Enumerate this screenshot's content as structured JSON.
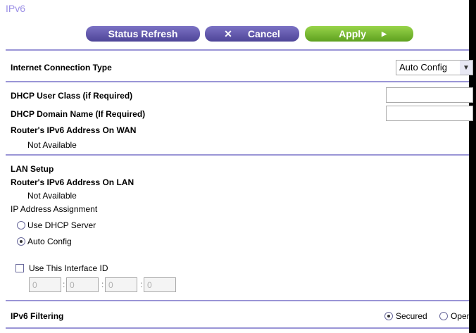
{
  "page": {
    "title": "IPv6"
  },
  "toolbar": {
    "status_refresh_label": "Status Refresh",
    "cancel_label": "Cancel",
    "apply_label": "Apply"
  },
  "internet_connection": {
    "label": "Internet Connection Type",
    "selected": "Auto Config"
  },
  "dhcp": {
    "user_class_label": "DHCP User Class (if Required)",
    "user_class_value": "",
    "domain_name_label": "DHCP Domain Name  (If Required)",
    "domain_name_value": ""
  },
  "wan": {
    "address_label": "Router's IPv6 Address On WAN",
    "address_value": "Not Available"
  },
  "lan": {
    "section_label": "LAN Setup",
    "address_label": "Router's IPv6 Address On LAN",
    "address_value": "Not Available",
    "assignment_label": "IP Address Assignment",
    "option_dhcp": "Use DHCP Server",
    "option_auto": "Auto Config",
    "selected_option": "Auto Config",
    "interface_id_label": "Use This Interface ID",
    "interface_id_checked": false,
    "interface_id": [
      "0",
      "0",
      "0",
      "0"
    ]
  },
  "filtering": {
    "label": "IPv6 Filtering",
    "option_secured": "Secured",
    "option_open": "Open",
    "selected": "Secured"
  }
}
